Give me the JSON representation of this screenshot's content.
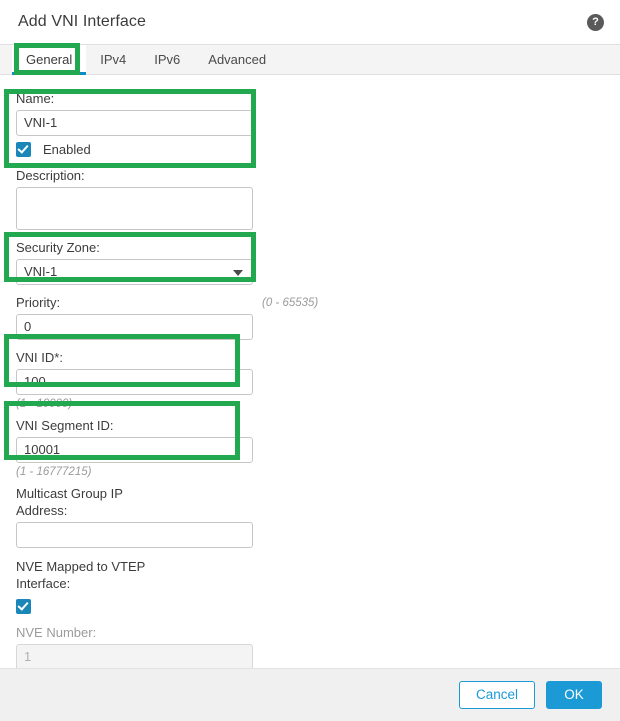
{
  "dialog": {
    "title": "Add VNI Interface",
    "help_icon": "help-circle-icon",
    "help_glyph": "?"
  },
  "tabs": [
    {
      "label": "General",
      "active": true
    },
    {
      "label": "IPv4",
      "active": false
    },
    {
      "label": "IPv6",
      "active": false
    },
    {
      "label": "Advanced",
      "active": false
    }
  ],
  "form": {
    "name": {
      "label": "Name:",
      "value": "VNI-1",
      "placeholder": ""
    },
    "enabled": {
      "label": "Enabled",
      "checked": true
    },
    "description": {
      "label": "Description:",
      "value": "",
      "placeholder": ""
    },
    "security_zone": {
      "label": "Security Zone:",
      "value": "VNI-1",
      "caret_icon": "chevron-down-icon"
    },
    "priority": {
      "label": "Priority:",
      "value": "0",
      "hint": "(0 - 65535)"
    },
    "vni_id": {
      "label": "VNI ID*:",
      "value": "100",
      "hint": "(1 - 10000)"
    },
    "vni_segment_id": {
      "label": "VNI Segment ID:",
      "value": "10001",
      "hint": "(1 - 16777215)"
    },
    "multicast_group_ip": {
      "label": "Multicast Group IP Address:",
      "value": "",
      "placeholder": ""
    },
    "nve_mapped": {
      "label": "NVE Mapped to VTEP Interface:",
      "checked": true
    },
    "nve_number": {
      "label": "NVE Number:",
      "value": "1",
      "disabled": true
    }
  },
  "footer": {
    "cancel_label": "Cancel",
    "ok_label": "OK"
  },
  "colors": {
    "annotation_green": "#22a84e",
    "primary_blue": "#1b9ad6",
    "tab_underline": "#0d8dc4",
    "checkbox_blue": "#1b87b9"
  }
}
